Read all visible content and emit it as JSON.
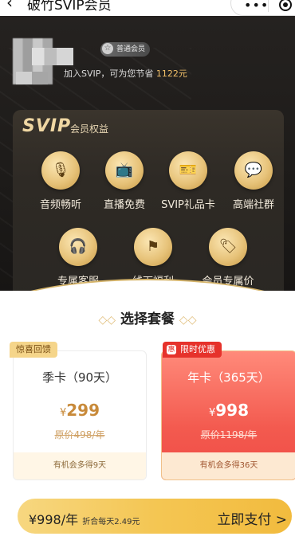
{
  "nav": {
    "back_glyph": "‹",
    "title": "破竹SVIP会员",
    "more_glyph": "•••"
  },
  "user": {
    "badge_icon": "☆",
    "badge": "普通会员",
    "save_prefix": "加入SVIP，可为您节省",
    "save_amount": "1122元"
  },
  "benefits": {
    "title": "SVIP",
    "subtitle": "会员权益",
    "items": [
      {
        "label": "音频畅听",
        "icon": "microphone-icon",
        "glyph": "🎙"
      },
      {
        "label": "直播免费",
        "icon": "tv-icon",
        "glyph": "📺"
      },
      {
        "label": "SVIP礼品卡",
        "icon": "gift-card-icon",
        "glyph": "🎫"
      },
      {
        "label": "高端社群",
        "icon": "chat-bubbles-icon",
        "glyph": "💬"
      },
      {
        "label": "专属客服",
        "icon": "headset-icon",
        "glyph": "🎧"
      },
      {
        "label": "线下福利",
        "icon": "flag-icon",
        "glyph": "⚑"
      },
      {
        "label": "会员专属价",
        "icon": "price-tag-icon",
        "glyph": "🏷"
      }
    ]
  },
  "plans": {
    "section_title": "选择套餐",
    "diamonds": "◇◇",
    "items": [
      {
        "tag": "惊喜回馈",
        "name": "季卡（90天）",
        "currency": "¥",
        "price": "299",
        "original": "原价498/年",
        "note": "有机会多得9天"
      },
      {
        "tag_icon": "惠",
        "tag": "限时优惠",
        "name": "年卡（365天）",
        "currency": "¥",
        "price": "998",
        "original": "原价1198/年",
        "note": "有机会多得36天"
      }
    ]
  },
  "pay": {
    "price": "¥998/年",
    "per_day": "折合每天2.49元",
    "button": "立即支付 >"
  },
  "colors": {
    "gold": "#e7c37a",
    "dark": "#1d1b19",
    "red": "#ef4b45",
    "pay_gradient_start": "#f7d780",
    "pay_gradient_end": "#f2bb3e"
  }
}
